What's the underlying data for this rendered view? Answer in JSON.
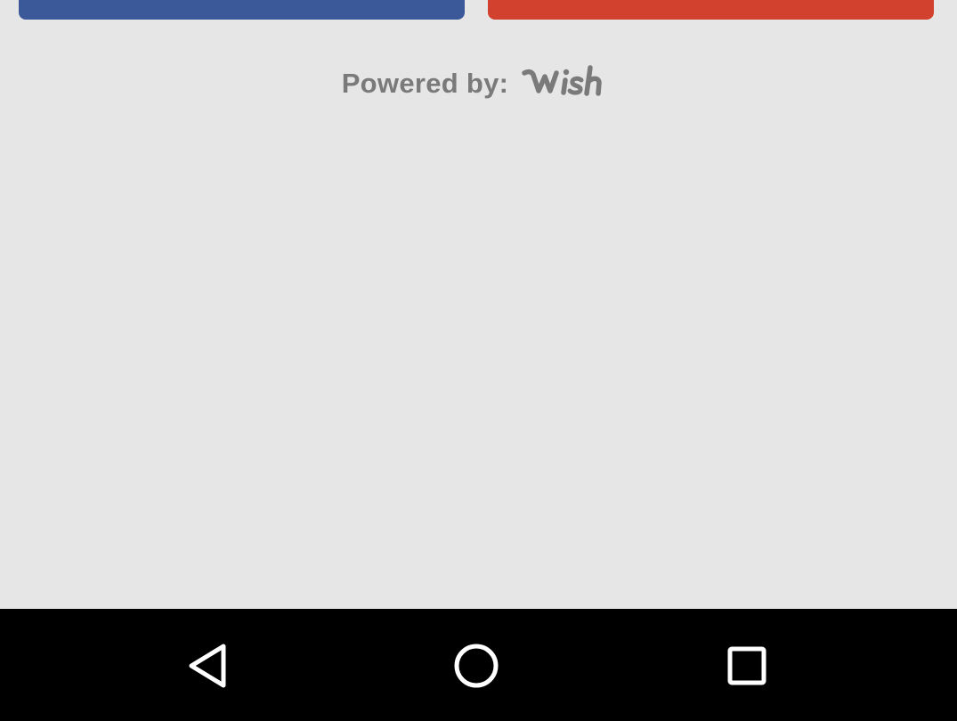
{
  "buttons": {
    "left": {
      "color": "#3b5998"
    },
    "right": {
      "color": "#d2412d"
    }
  },
  "powered": {
    "label": "Powered by:",
    "logo_text": "wish",
    "color": "#7a7a7a"
  },
  "navbar": {
    "background": "#000000",
    "icons": [
      "back-icon",
      "home-icon",
      "recents-icon"
    ]
  },
  "background": "#e6e6e6"
}
